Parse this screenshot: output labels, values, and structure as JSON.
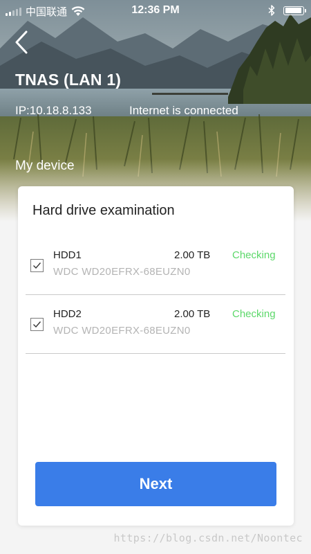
{
  "status_bar": {
    "carrier": "中国联通",
    "time": "12:36 PM",
    "signal_bars_filled": 2,
    "signal_bars_total": 5,
    "icons": [
      "wifi-icon",
      "bluetooth-icon",
      "battery-icon"
    ],
    "battery_level": 0.92
  },
  "header": {
    "back_icon": "chevron-left-icon",
    "device_name": "TNAS (LAN 1)",
    "ip": "IP:10.18.8.133",
    "internet_status": "Internet is connected",
    "section_label": "My device"
  },
  "card": {
    "title": "Hard drive examination",
    "drives": [
      {
        "name": "HDD1",
        "model": "WDC WD20EFRX-68EUZN0",
        "size": "2.00 TB",
        "status": "Checking",
        "checked": true
      },
      {
        "name": "HDD2",
        "model": "WDC WD20EFRX-68EUZN0",
        "size": "2.00 TB",
        "status": "Checking",
        "checked": true
      }
    ],
    "next_label": "Next"
  },
  "watermark": "https://blog.csdn.net/Noontec",
  "colors": {
    "accent": "#3a7de8",
    "status_checking": "#5cd86a",
    "model_text": "#b4b4b4"
  }
}
